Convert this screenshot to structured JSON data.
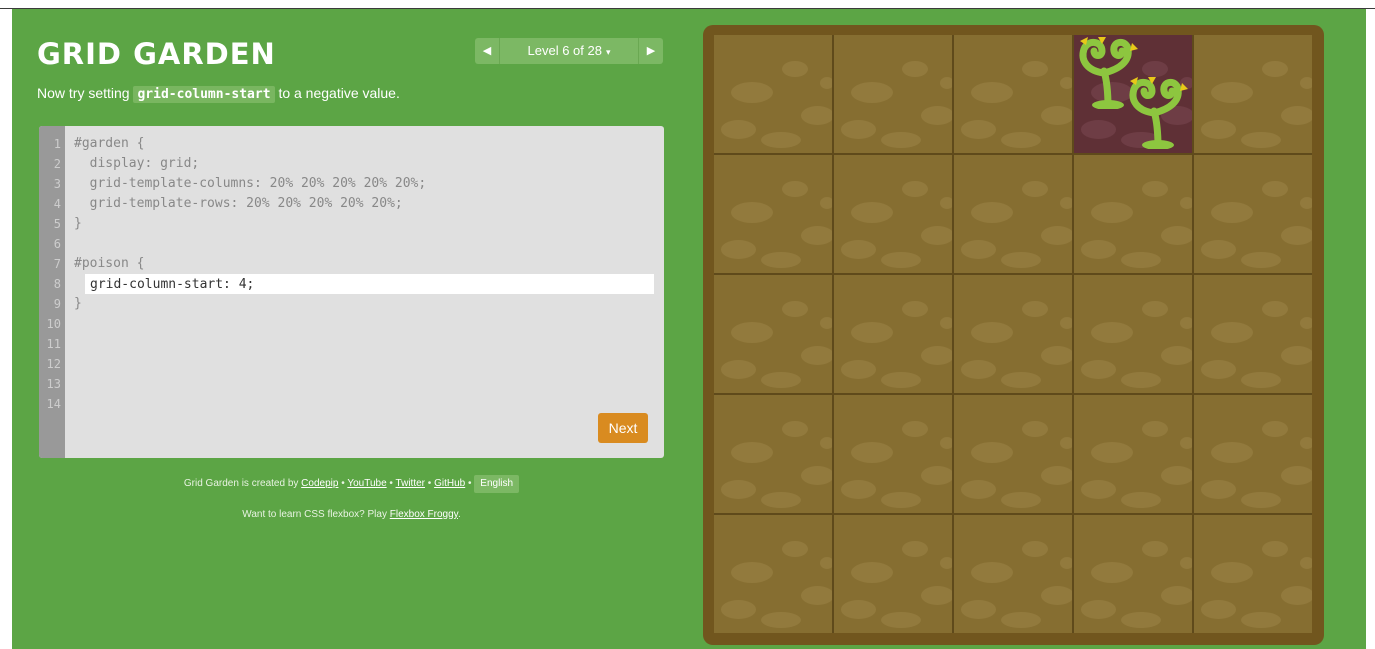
{
  "header": {
    "title": "GRID GARDEN",
    "instruction_before": "Now try setting",
    "instruction_code": "grid-column-start",
    "instruction_after": "to a negative value."
  },
  "level_nav": {
    "prev_icon": "triangle-left",
    "next_icon": "triangle-right",
    "label": "Level 6 of 28",
    "caret": "▾"
  },
  "editor": {
    "line_numbers": [
      "1",
      "2",
      "3",
      "4",
      "5",
      "6",
      "7",
      "8",
      "9",
      "10",
      "11",
      "12",
      "13",
      "14"
    ],
    "lines": [
      "#garden {",
      "  display: grid;",
      "  grid-template-columns: 20% 20% 20% 20% 20%;",
      "  grid-template-rows: 20% 20% 20% 20% 20%;",
      "}",
      "",
      "#poison {",
      "",
      "}"
    ],
    "input_value": "grid-column-start: 4;",
    "next_label": "Next"
  },
  "footer": {
    "created_by": "Grid Garden is created by",
    "links": [
      "Codepip",
      "YouTube",
      "Twitter",
      "GitHub"
    ],
    "separator": "•",
    "language": "English",
    "flexbox_prompt": "Want to learn CSS flexbox? Play",
    "flexbox_link": "Flexbox Froggy",
    "flexbox_end": "."
  },
  "garden": {
    "columns": 5,
    "rows": 5,
    "poison_cell": {
      "row": 1,
      "column": 4
    },
    "soil_color": "#866e31",
    "poison_color": "#5f3036",
    "weed_color": "#8dc63f",
    "weed_icon": "weed-icon"
  },
  "colors": {
    "page_bg": "#5ca545",
    "next_button": "#d98b20",
    "frame": "#71561e"
  }
}
